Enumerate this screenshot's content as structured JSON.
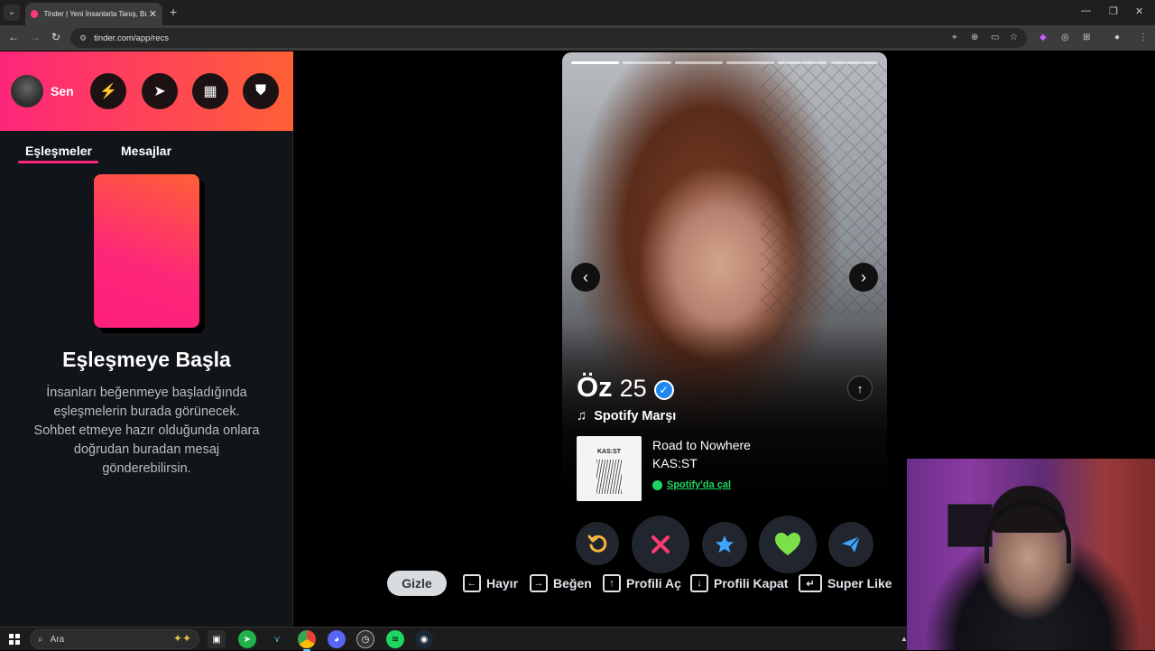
{
  "browser": {
    "tab_title": "Tinder | Yeni İnsanlarla Tanış, Bu",
    "url": "tinder.com/app/recs"
  },
  "sidebar": {
    "profile_label": "Sen",
    "tabs": [
      {
        "label": "Eşleşmeler",
        "active": true
      },
      {
        "label": "Mesajlar",
        "active": false
      }
    ],
    "empty_title": "Eşleşmeye Başla",
    "empty_desc": "İnsanları beğenmeye başladığında eşleşmelerin burada görünecek. Sohbet etmeye hazır olduğunda onlara doğrudan buradan mesaj gönderebilirsin."
  },
  "profile": {
    "name": "Öz",
    "age": "25",
    "anthem_label": "Spotify Marşı",
    "song": "Road to Nowhere",
    "artist": "KAS:ST",
    "album_text": "KAS:ST",
    "spotify_link": "Spotify'da çal",
    "photo_count": 6,
    "active_photo": 1
  },
  "hints": {
    "hide": "Gizle",
    "nope": "Hayır",
    "like": "Beğen",
    "open_profile": "Profili Aç",
    "close_profile": "Profili Kapat",
    "super_like": "Super Like"
  },
  "taskbar": {
    "search_placeholder": "Ara"
  },
  "colors": {
    "brand_start": "#fd267a",
    "brand_end": "#ff6036",
    "spotify": "#1ed760",
    "verified": "#1e88f0"
  }
}
